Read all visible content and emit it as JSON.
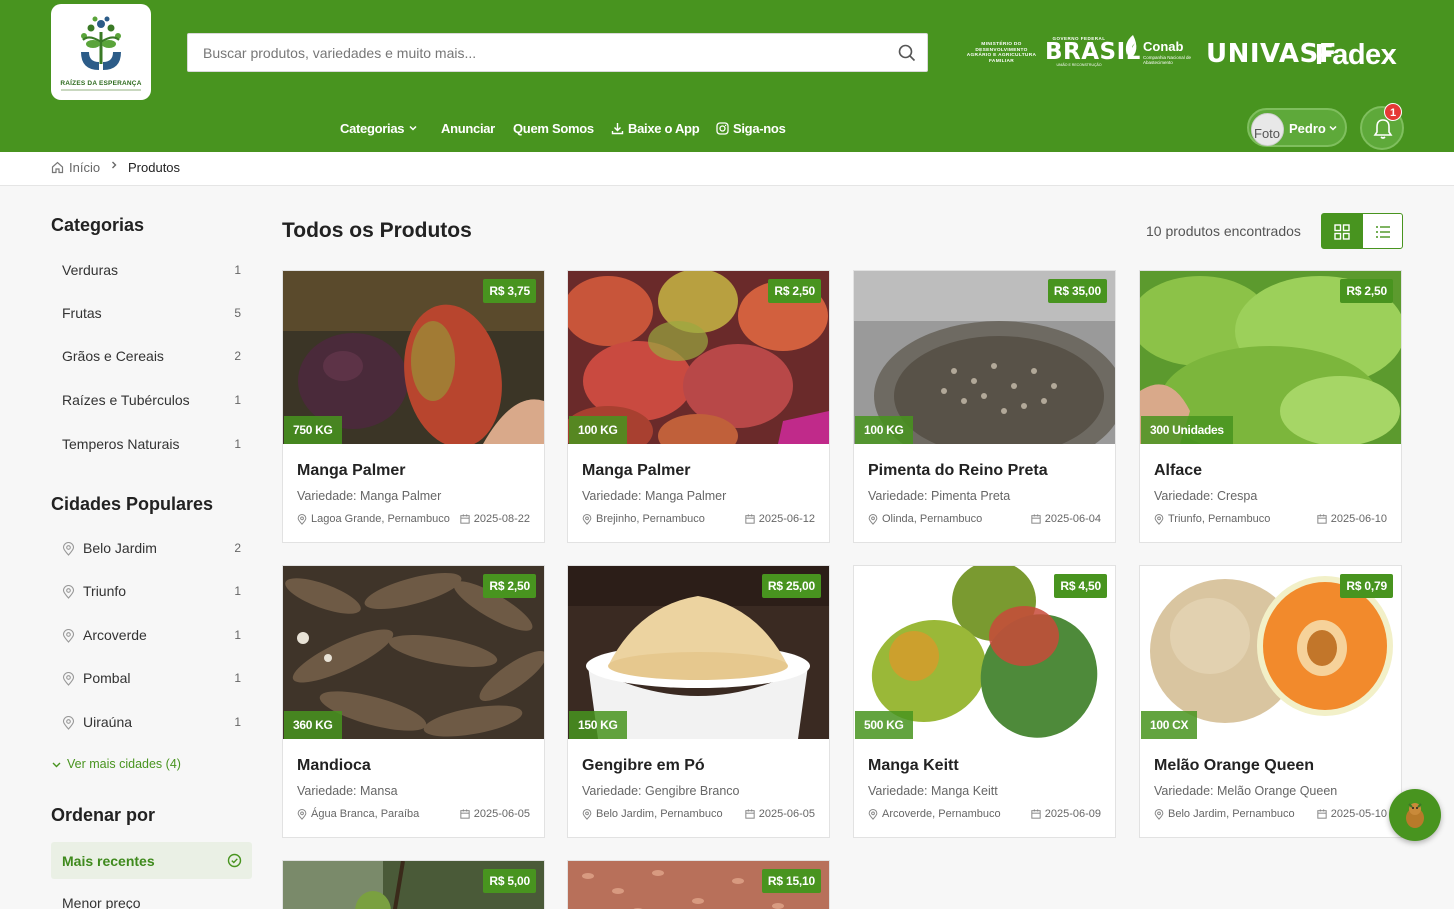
{
  "brand": {
    "name": "RAÍZES DA ESPERANÇA"
  },
  "search": {
    "placeholder": "Buscar produtos, variedades e muito mais..."
  },
  "partners": {
    "ministerio": "MINISTÉRIO DO DESENVOLVIMENTO AGRÁRIO E AGRICULTURA FAMILIAR",
    "gov_top": "GOVERNO FEDERAL",
    "brasil": "BRASIL",
    "gov_sub": "UNIÃO E RECONSTRUÇÃO",
    "conab": "Conab",
    "conab_sub": "Companhia Nacional de Abastecimento",
    "univasf": "UNIVASF",
    "fadex": "Fadex"
  },
  "nav": {
    "categorias": "Categorias",
    "anunciar": "Anunciar",
    "quem_somos": "Quem Somos",
    "baixe_app": "Baixe o App",
    "siga_nos": "Siga-nos"
  },
  "user": {
    "avatar_alt": "Foto",
    "name": "Pedro",
    "notifications": "1"
  },
  "breadcrumb": {
    "home": "Início",
    "current": "Produtos"
  },
  "sidebar": {
    "categories_title": "Categorias",
    "categories": [
      {
        "label": "Verduras",
        "count": "1"
      },
      {
        "label": "Frutas",
        "count": "5"
      },
      {
        "label": "Grãos e Cereais",
        "count": "2"
      },
      {
        "label": "Raízes e Tubérculos",
        "count": "1"
      },
      {
        "label": "Temperos Naturais",
        "count": "1"
      }
    ],
    "cities_title": "Cidades Populares",
    "cities": [
      {
        "label": "Belo Jardim",
        "count": "2"
      },
      {
        "label": "Triunfo",
        "count": "1"
      },
      {
        "label": "Arcoverde",
        "count": "1"
      },
      {
        "label": "Pombal",
        "count": "1"
      },
      {
        "label": "Uiraúna",
        "count": "1"
      }
    ],
    "more_cities": "Ver mais cidades (4)",
    "sort_title": "Ordenar por",
    "sort_active": "Mais recentes",
    "sort_next": "Menor preço"
  },
  "main": {
    "title": "Todos os Produtos",
    "found": "10 produtos encontrados"
  },
  "products": [
    {
      "name": "Manga Palmer",
      "variety": "Variedade: Manga Palmer",
      "location": "Lagoa Grande, Pernambuco",
      "date": "2025-08-22",
      "price": "R$ 3,75",
      "qty": "750 KG"
    },
    {
      "name": "Manga Palmer",
      "variety": "Variedade: Manga Palmer",
      "location": "Brejinho, Pernambuco",
      "date": "2025-06-12",
      "price": "R$ 2,50",
      "qty": "100 KG"
    },
    {
      "name": "Pimenta do Reino Preta",
      "variety": "Variedade: Pimenta Preta",
      "location": "Olinda, Pernambuco",
      "date": "2025-06-04",
      "price": "R$ 35,00",
      "qty": "100 KG"
    },
    {
      "name": "Alface",
      "variety": "Variedade: Crespa",
      "location": "Triunfo, Pernambuco",
      "date": "2025-06-10",
      "price": "R$ 2,50",
      "qty": "300 Unidades"
    },
    {
      "name": "Mandioca",
      "variety": "Variedade: Mansa",
      "location": "Água Branca, Paraíba",
      "date": "2025-06-05",
      "price": "R$ 2,50",
      "qty": "360 KG"
    },
    {
      "name": "Gengibre em Pó",
      "variety": "Variedade: Gengibre Branco",
      "location": "Belo Jardim, Pernambuco",
      "date": "2025-06-05",
      "price": "R$ 25,00",
      "qty": "150 KG"
    },
    {
      "name": "Manga Keitt",
      "variety": "Variedade: Manga Keitt",
      "location": "Arcoverde, Pernambuco",
      "date": "2025-06-09",
      "price": "R$ 4,50",
      "qty": "500 KG"
    },
    {
      "name": "Melão Orange Queen",
      "variety": "Variedade: Melão Orange Queen",
      "location": "Belo Jardim, Pernambuco",
      "date": "2025-05-10",
      "price": "R$ 0,79",
      "qty": "100 CX"
    },
    {
      "price": "R$ 5,00"
    },
    {
      "price": "R$ 15,10"
    }
  ],
  "colors": {
    "brand_green": "#48941f",
    "badge_red": "#e53935"
  }
}
